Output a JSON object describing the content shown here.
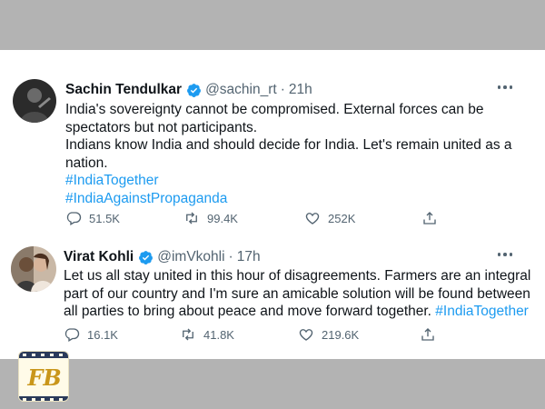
{
  "tweets": [
    {
      "author_name": "Sachin Tendulkar",
      "handle": "@sachin_rt",
      "separator": "·",
      "time": "21h",
      "body_lines": [
        "India's sovereignty cannot be compromised. External forces can be",
        "spectators but not participants.",
        "Indians know India and should decide for India. Let's remain united as a",
        "nation."
      ],
      "hashtags": [
        "#IndiaTogether",
        "#IndiaAgainstPropaganda"
      ],
      "replies": "51.5K",
      "retweets": "99.4K",
      "likes": "252K"
    },
    {
      "author_name": "Virat Kohli",
      "handle": "@imVkohli",
      "separator": "·",
      "time": "17h",
      "body_lines": [
        "Let us all stay united in this hour of disagreements. Farmers are an integral",
        "part of our country and I'm sure an amicable solution will be found between",
        "all parties to bring about peace and move forward together."
      ],
      "inline_hashtag": "#IndiaTogether",
      "replies": "16.1K",
      "retweets": "41.8K",
      "likes": "219.6K"
    }
  ],
  "watermark": {
    "text": "FB"
  },
  "colors": {
    "link": "#1d9bf0",
    "muted": "#536471",
    "verified": "#1d9bf0",
    "band": "#b3b3b3",
    "watermark_text": "#c9961a"
  }
}
